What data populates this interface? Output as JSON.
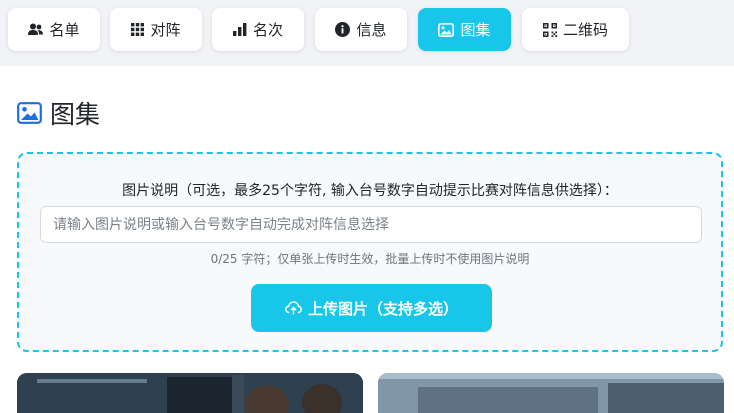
{
  "tabs": [
    {
      "label": "名单",
      "icon": "users-icon",
      "active": false
    },
    {
      "label": "对阵",
      "icon": "grid-icon",
      "active": false
    },
    {
      "label": "名次",
      "icon": "bar-chart-icon",
      "active": false
    },
    {
      "label": "信息",
      "icon": "info-icon",
      "active": false
    },
    {
      "label": "图集",
      "icon": "image-icon",
      "active": true
    },
    {
      "label": "二维码",
      "icon": "qrcode-icon",
      "active": false
    }
  ],
  "page": {
    "title": "图集",
    "title_icon": "image-icon"
  },
  "upload_panel": {
    "description_label": "图片说明（可选，最多25个字符, 输入台号数字自动提示比赛对阵信息供选择）：",
    "input_placeholder": "请输入图片说明或输入台号数字自动完成对阵信息选择",
    "input_value": "",
    "char_hint": "0/25 字符；仅单张上传时生效，批量上传时不使用图片说明",
    "upload_button_label": "上传图片（支持多选）",
    "upload_icon": "cloud-upload-icon"
  },
  "gallery": {
    "photos": [
      "photo-1",
      "photo-2"
    ]
  },
  "colors": {
    "accent": "#17c6e8",
    "title_icon": "#1a6fe0",
    "topbar_bg": "#f1f3f6"
  }
}
